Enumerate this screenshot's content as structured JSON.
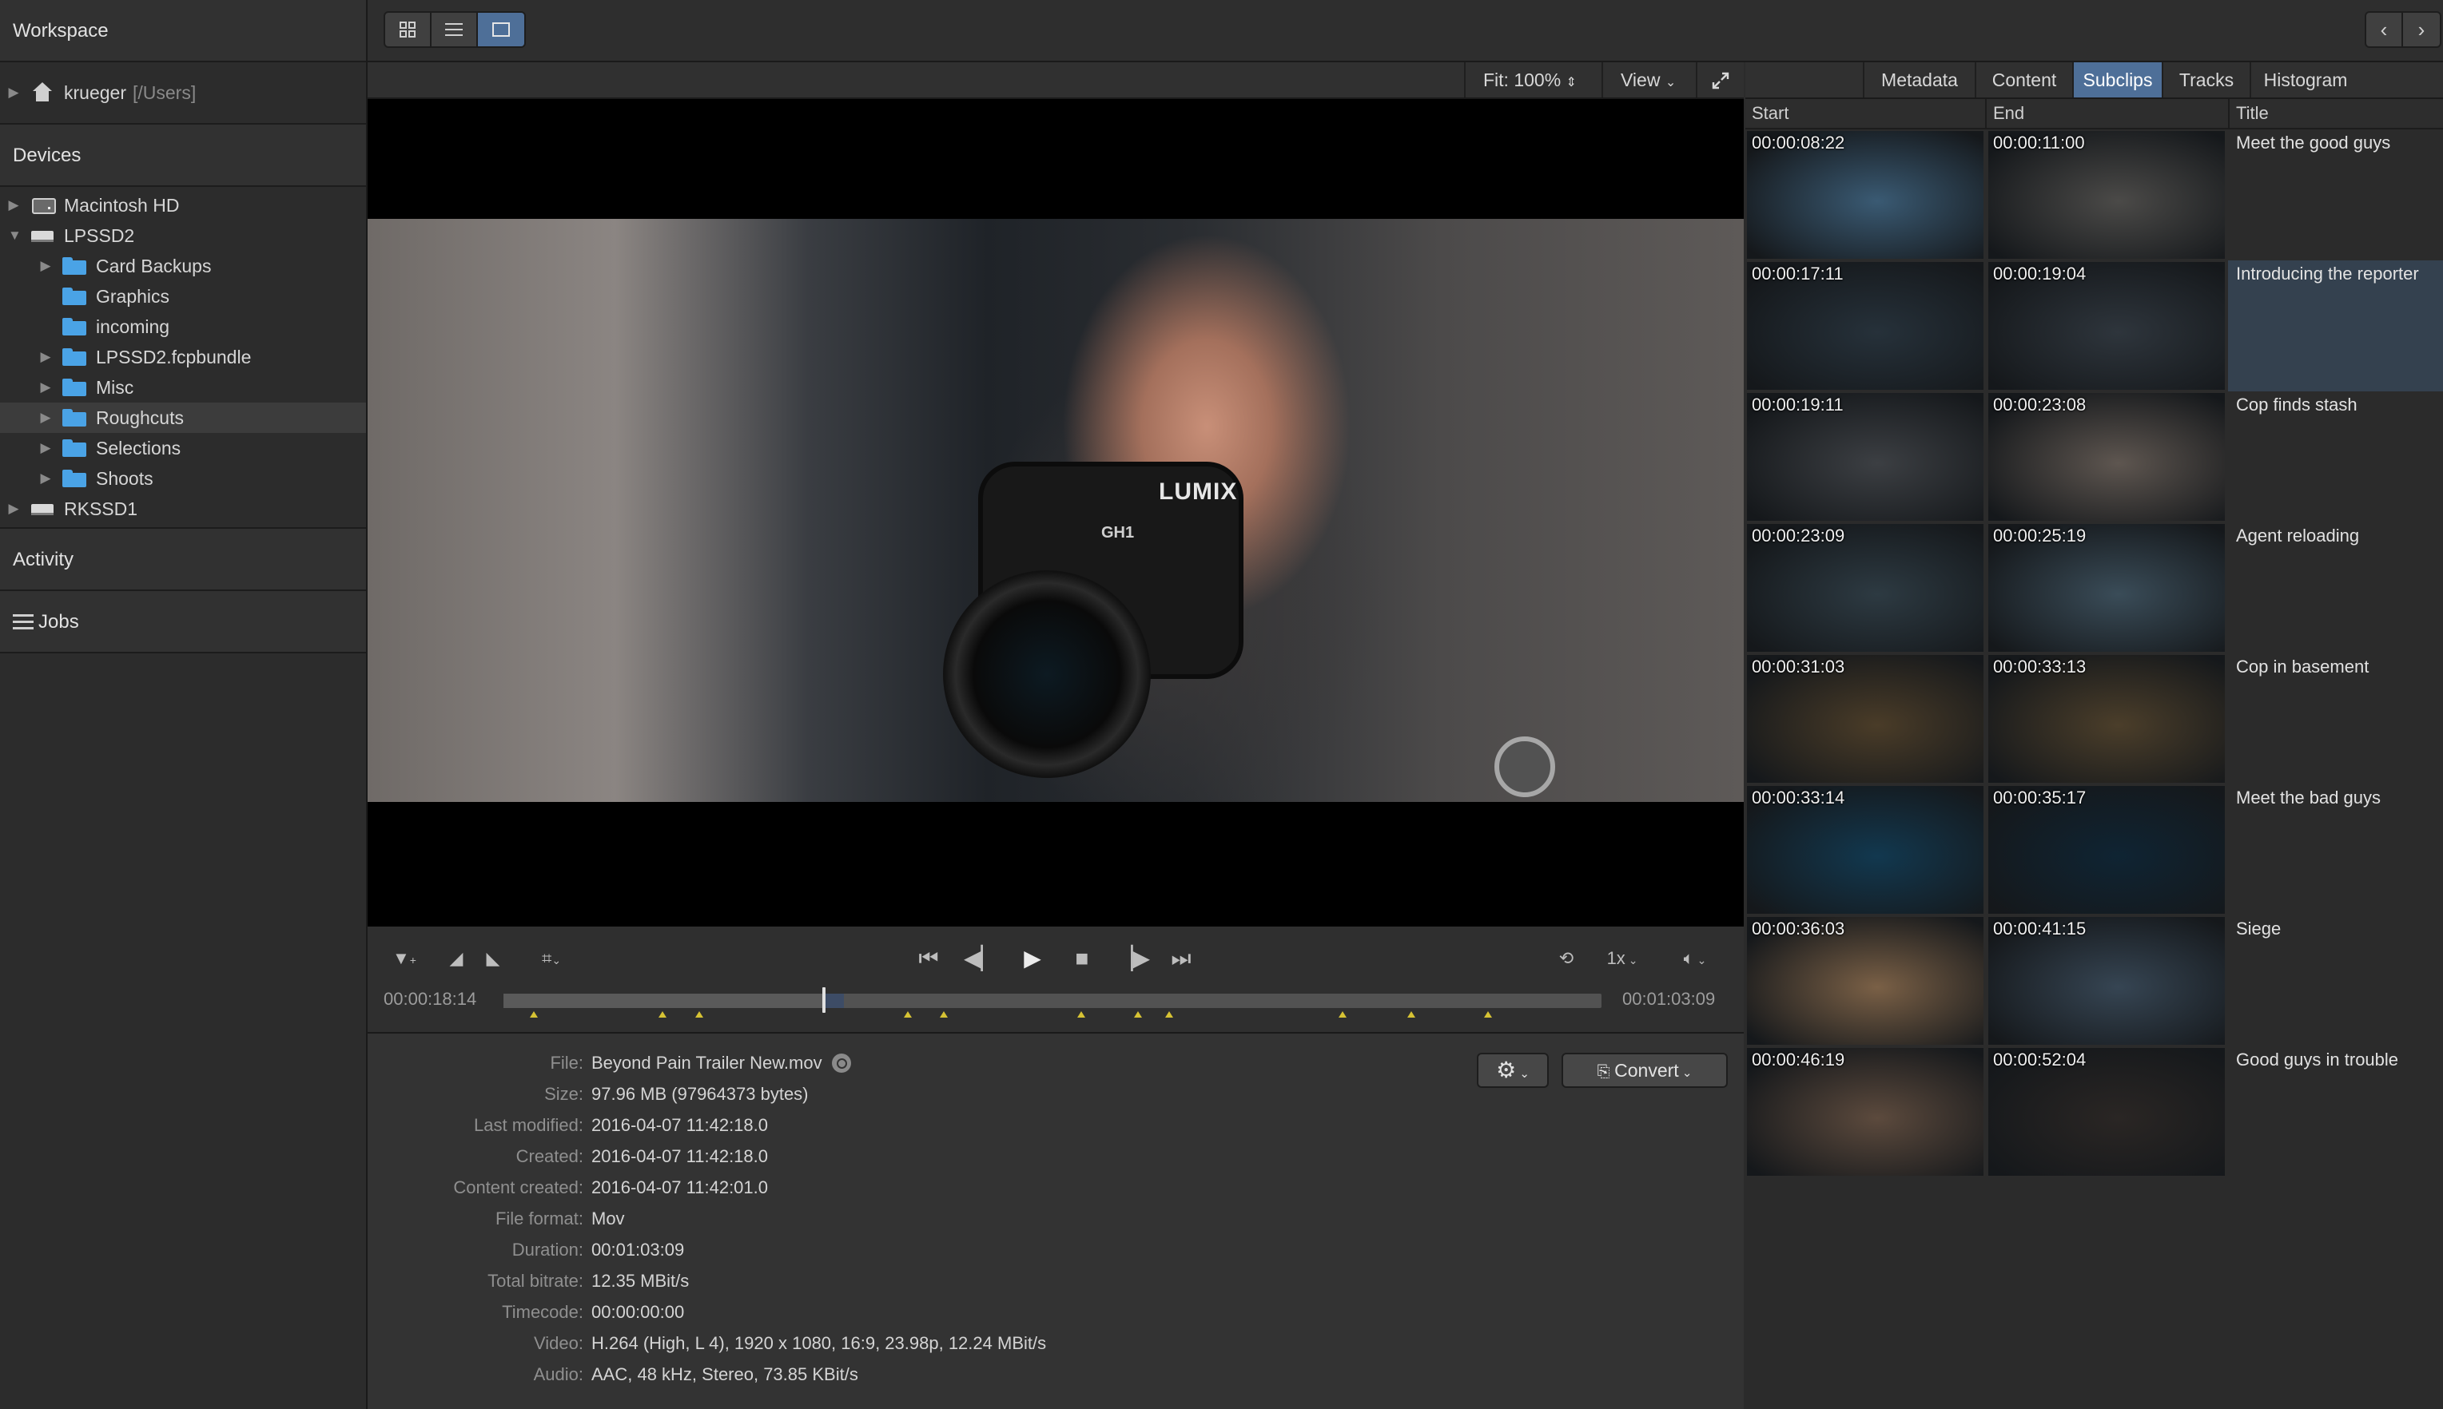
{
  "sidebar": {
    "workspace": "Workspace",
    "home": {
      "name": "krueger",
      "path": "[/Users]"
    },
    "devices_label": "Devices",
    "devices": [
      {
        "label": "Macintosh HD",
        "icon": "hard-disk-icon",
        "level": 0,
        "expand": "collapsed"
      },
      {
        "label": "LPSSD2",
        "icon": "external-drive-icon",
        "level": 0,
        "expand": "expanded"
      },
      {
        "label": "Card Backups",
        "icon": "folder-icon",
        "level": 1,
        "expand": "collapsed"
      },
      {
        "label": "Graphics",
        "icon": "folder-icon",
        "level": 1,
        "expand": "none"
      },
      {
        "label": "incoming",
        "icon": "folder-icon",
        "level": 1,
        "expand": "none"
      },
      {
        "label": "LPSSD2.fcpbundle",
        "icon": "folder-icon",
        "level": 1,
        "expand": "collapsed"
      },
      {
        "label": "Misc",
        "icon": "folder-icon",
        "level": 1,
        "expand": "collapsed"
      },
      {
        "label": "Roughcuts",
        "icon": "folder-icon",
        "level": 1,
        "expand": "collapsed",
        "selected": true
      },
      {
        "label": "Selections",
        "icon": "folder-icon",
        "level": 1,
        "expand": "collapsed"
      },
      {
        "label": "Shoots",
        "icon": "folder-icon",
        "level": 1,
        "expand": "collapsed"
      },
      {
        "label": "RKSSD1",
        "icon": "external-drive-icon",
        "level": 0,
        "expand": "collapsed"
      }
    ],
    "activity_label": "Activity",
    "jobs_label": "Jobs"
  },
  "toolbar": {
    "view_modes": [
      "grid-view-icon",
      "list-view-icon",
      "single-view-icon"
    ],
    "active_view": 2,
    "nav_back": "‹",
    "nav_forward": "›"
  },
  "viewer": {
    "fit_label": "Fit: 100%",
    "view_label": "View",
    "frame_brand": "LUMIX",
    "frame_model": "GH1"
  },
  "transport": {
    "current_timecode": "00:00:18:14",
    "duration_timecode": "00:01:03:09",
    "speed": "1x",
    "progress_fraction": 0.292,
    "selection_fraction": [
      0.292,
      0.31
    ],
    "marker_fractions": [
      0.028,
      0.145,
      0.178,
      0.368,
      0.401,
      0.526,
      0.578,
      0.606,
      0.764,
      0.827,
      0.897
    ]
  },
  "file_info": {
    "settings_icon": "gear-icon",
    "convert_label": "Convert",
    "rows": [
      {
        "label": "File:",
        "value": "Beyond Pain Trailer New.mov"
      },
      {
        "label": "Size:",
        "value": "97.96 MB (97964373 bytes)"
      },
      {
        "label": "Last modified:",
        "value": "2016-04-07 11:42:18.0"
      },
      {
        "label": "Created:",
        "value": "2016-04-07 11:42:18.0"
      },
      {
        "label": "Content created:",
        "value": "2016-04-07 11:42:01.0"
      },
      {
        "label": "File format:",
        "value": "Mov"
      },
      {
        "label": "Duration:",
        "value": "00:01:03:09"
      },
      {
        "label": "Total bitrate:",
        "value": "12.35 MBit/s"
      },
      {
        "label": "Timecode:",
        "value": "00:00:00:00"
      },
      {
        "label": "Video:",
        "value": "H.264 (High, L 4), 1920 x 1080, 16:9, 23.98p, 12.24 MBit/s"
      },
      {
        "label": "Audio:",
        "value": "AAC, 48 kHz, Stereo, 73.85 KBit/s"
      }
    ]
  },
  "inspector": {
    "tabs": [
      "Metadata",
      "Content",
      "Subclips",
      "Tracks",
      "Histogram"
    ],
    "active_tab": "Subclips",
    "columns": {
      "start": "Start",
      "end": "End",
      "title": "Title"
    },
    "subclips": [
      {
        "start": "00:00:08:22",
        "end": "00:00:11:00",
        "title": "Meet the good guys",
        "start_color": "#3a5a73",
        "end_color": "#4b4a48"
      },
      {
        "start": "00:00:17:11",
        "end": "00:00:19:04",
        "title": "Introducing the reporter",
        "start_color": "#26313a",
        "end_color": "#2e353c",
        "highlighted": true
      },
      {
        "start": "00:00:19:11",
        "end": "00:00:23:08",
        "title": "Cop finds stash",
        "start_color": "#3c3f43",
        "end_color": "#5e5650"
      },
      {
        "start": "00:00:23:09",
        "end": "00:00:25:19",
        "title": "Agent reloading",
        "start_color": "#2d3a42",
        "end_color": "#3a4c58"
      },
      {
        "start": "00:00:31:03",
        "end": "00:00:33:13",
        "title": "Cop in basement",
        "start_color": "#4a3c28",
        "end_color": "#4b3e2a"
      },
      {
        "start": "00:00:33:14",
        "end": "00:00:35:17",
        "title": "Meet the bad guys",
        "start_color": "#12384f",
        "end_color": "#0f2433"
      },
      {
        "start": "00:00:36:03",
        "end": "00:00:41:15",
        "title": "Siege",
        "start_color": "#7a6046",
        "end_color": "#364553"
      },
      {
        "start": "00:00:46:19",
        "end": "00:00:52:04",
        "title": "Good guys in trouble",
        "start_color": "#5c4a3d",
        "end_color": "#2a2624"
      }
    ]
  }
}
